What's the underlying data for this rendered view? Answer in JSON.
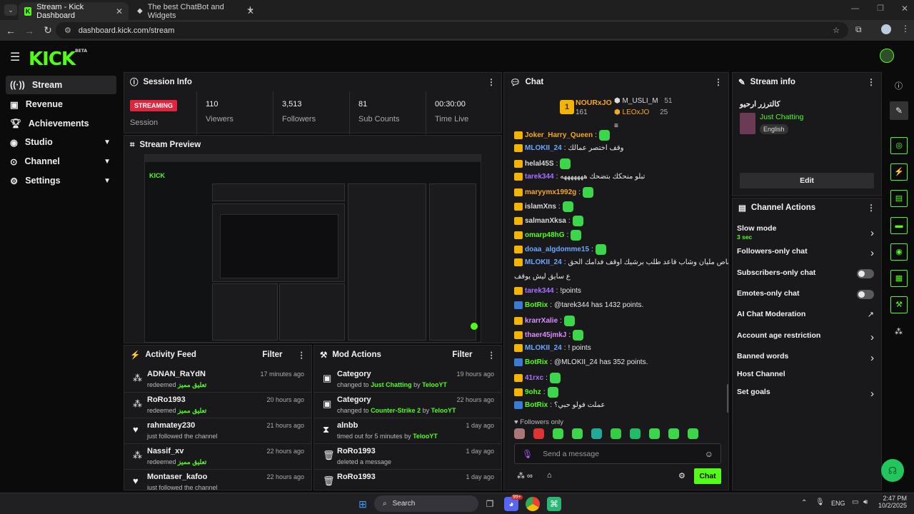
{
  "browser": {
    "tabs": [
      {
        "title": "Stream - Kick Dashboard",
        "active": true
      },
      {
        "title": "The best ChatBot and Widgets",
        "active": false
      }
    ],
    "url": "dashboard.kick.com/stream"
  },
  "app": {
    "logo": "KICK",
    "logo_badge": "BETA",
    "nav": [
      {
        "label": "Stream",
        "icon": "broadcast-icon",
        "active": true,
        "expandable": false
      },
      {
        "label": "Revenue",
        "icon": "money-icon",
        "active": false,
        "expandable": false
      },
      {
        "label": "Achievements",
        "icon": "trophy-icon",
        "active": false,
        "expandable": false
      },
      {
        "label": "Studio",
        "icon": "studio-icon",
        "active": false,
        "expandable": true
      },
      {
        "label": "Channel",
        "icon": "channel-icon",
        "active": false,
        "expandable": true
      },
      {
        "label": "Settings",
        "icon": "gear-icon",
        "active": false,
        "expandable": true
      }
    ]
  },
  "session": {
    "title": "Session Info",
    "status_badge": "STREAMING",
    "status_label": "Session",
    "stats": [
      {
        "value": "110",
        "label": "Viewers"
      },
      {
        "value": "3,513",
        "label": "Followers"
      },
      {
        "value": "81",
        "label": "Sub Counts"
      },
      {
        "value": "00:30:00",
        "label": "Time Live"
      }
    ]
  },
  "preview": {
    "title": "Stream Preview"
  },
  "activity": {
    "title": "Activity Feed",
    "filter_label": "Filter",
    "items": [
      {
        "name": "ADNAN_RaYdN",
        "desc": "redeemed",
        "highlight": "تعليق مميز",
        "time": "17 minutes ago",
        "icon": "redeem-icon"
      },
      {
        "name": "RoRo1993",
        "desc": "redeemed",
        "highlight": "تعليق مميز",
        "time": "20 hours ago",
        "icon": "redeem-icon"
      },
      {
        "name": "rahmatey230",
        "desc": "just followed the channel",
        "highlight": "",
        "time": "21 hours ago",
        "icon": "heart-icon"
      },
      {
        "name": "Nassif_xv",
        "desc": "redeemed",
        "highlight": "تعليق مميز",
        "time": "22 hours ago",
        "icon": "redeem-icon"
      },
      {
        "name": "Montaser_kafoo",
        "desc": "just followed the channel",
        "highlight": "",
        "time": "22 hours ago",
        "icon": "heart-icon"
      }
    ]
  },
  "mod": {
    "title": "Mod Actions",
    "filter_label": "Filter",
    "items": [
      {
        "name": "Category",
        "pre": "changed to",
        "target": "Just Chatting",
        "mid": "by",
        "by": "TelooYT",
        "time": "19 hours ago",
        "icon": "category-icon"
      },
      {
        "name": "Category",
        "pre": "changed to",
        "target": "Counter-Strike 2",
        "mid": "by",
        "by": "TelooYT",
        "time": "22 hours ago",
        "icon": "category-icon"
      },
      {
        "name": "alnbb",
        "pre": "timed out for 5 minutes",
        "target": "",
        "mid": "by",
        "by": "TelooYT",
        "time": "1 day ago",
        "icon": "hourglass-icon"
      },
      {
        "name": "RoRo1993",
        "pre": "deleted a message",
        "target": "",
        "mid": "",
        "by": "",
        "time": "1 day ago",
        "icon": "trash-icon"
      },
      {
        "name": "RoRo1993",
        "pre": "",
        "target": "",
        "mid": "",
        "by": "",
        "time": "1 day ago",
        "icon": "trash-icon"
      }
    ]
  },
  "chat": {
    "title": "Chat",
    "leader": {
      "rank": "1",
      "name": "NOURxJO",
      "score": "161"
    },
    "leaders2": [
      {
        "name": "M_USLI_M",
        "score": "51"
      },
      {
        "name": "LEOxJO",
        "score": "25"
      }
    ],
    "messages": [
      {
        "user": "Joker_Harry_Queen",
        "color": "#f5a623",
        "text": "",
        "emote": true
      },
      {
        "user": "MLOKII_24",
        "color": "#6aa8ff",
        "text": "وقف اختصر عمالك",
        "emote": false
      },
      {
        "user": "helal45S",
        "color": "#d9d9d9",
        "text": "",
        "emote": true
      },
      {
        "user": "tarek344",
        "color": "#a970ff",
        "text": "تبلو منحكك بتضحك هههههههه",
        "emote": false
      },
      {
        "user": "maryymx1992g",
        "color": "#f5a623",
        "text": "",
        "emote": true
      },
      {
        "user": "islamXns",
        "color": "#d9d9d9",
        "text": "",
        "emote": true
      },
      {
        "user": "salmanXksa",
        "color": "#d9d9d9",
        "text": "",
        "emote": true
      },
      {
        "user": "omarp48hG",
        "color": "#53fc18",
        "text": "",
        "emote": true
      },
      {
        "user": "doaa_algdomme15",
        "color": "#6aa8ff",
        "text": "",
        "emote": true
      },
      {
        "user": "MLOKII_24",
        "color": "#6aa8ff",
        "text": "والله عيب افوت ع باص مليان وشاب قاعد طلب برشيك اوقف فدامك الحق",
        "emote": false
      },
      {
        "user": "",
        "color": "#e8e8e8",
        "text": "ع سايق ليش يوقف",
        "emote": false
      },
      {
        "user": "tarek344",
        "color": "#a970ff",
        "text": "!points",
        "emote": false
      },
      {
        "user": "BotRix",
        "color": "#53fc18",
        "text": "@tarek344 has 1432 points.",
        "emote": false
      },
      {
        "user": "krarrXalie",
        "color": "#d98cff",
        "text": "",
        "emote": true
      },
      {
        "user": "thaer45jmkJ",
        "color": "#d98cff",
        "text": "",
        "emote": true
      },
      {
        "user": "MLOKII_24",
        "color": "#6aa8ff",
        "text": "! points",
        "emote": false
      },
      {
        "user": "BotRix",
        "color": "#53fc18",
        "text": "@MLOKII_24 has 352 points.",
        "emote": false
      },
      {
        "user": "41rxc",
        "color": "#a970ff",
        "text": "",
        "emote": true
      },
      {
        "user": "9ohz",
        "color": "#53fc18",
        "text": "",
        "emote": true
      },
      {
        "user": "BotRix",
        "color": "#53fc18",
        "text": "عملت فولو حبي؟",
        "emote": false
      }
    ],
    "followers_only": "Followers only",
    "input_placeholder": "Send a message",
    "send_label": "Chat"
  },
  "stream_info": {
    "title": "Stream info",
    "stream_title": "كالترزر ارحيو",
    "category": "Just Chatting",
    "language": "English",
    "edit_label": "Edit"
  },
  "channel_actions": {
    "title": "Channel Actions",
    "items": [
      {
        "label": "Slow mode",
        "sub": "3 sec",
        "control": "arrow"
      },
      {
        "label": "Followers-only chat",
        "sub": "",
        "control": "arrow"
      },
      {
        "label": "Subscribers-only chat",
        "sub": "",
        "control": "toggle"
      },
      {
        "label": "Emotes-only chat",
        "sub": "",
        "control": "toggle"
      },
      {
        "label": "AI Chat Moderation",
        "sub": "",
        "control": "external"
      },
      {
        "label": "Account age restriction",
        "sub": "",
        "control": "arrow"
      },
      {
        "label": "Banned words",
        "sub": "",
        "control": "arrow"
      },
      {
        "label": "Host Channel",
        "sub": "",
        "control": "none"
      },
      {
        "label": "Set goals",
        "sub": "",
        "control": "arrow"
      }
    ]
  },
  "taskbar": {
    "search_label": "Search",
    "lang": "ENG",
    "time": "2:47 PM",
    "date": "10/2/2025",
    "notif_count": "99+"
  },
  "colors": {
    "accent": "#53fc18",
    "streaming": "#e0263f",
    "panel": "#19191b"
  }
}
